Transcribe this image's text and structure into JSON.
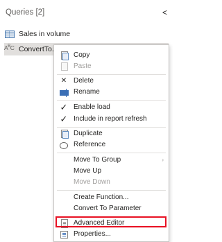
{
  "queries_pane": {
    "header": "Queries [2]",
    "collapse_glyph": "<",
    "items": [
      {
        "label": "Sales in volume",
        "icon": "table-icon"
      },
      {
        "label": "ConvertTo...",
        "icon": "abc-text-icon"
      }
    ]
  },
  "context_menu": {
    "copy": "Copy",
    "paste": "Paste",
    "delete": "Delete",
    "rename": "Rename",
    "enable_load": "Enable load",
    "include_refresh": "Include in report refresh",
    "duplicate": "Duplicate",
    "reference": "Reference",
    "move_to_group": "Move To Group",
    "move_up": "Move Up",
    "move_down": "Move Down",
    "create_function": "Create Function...",
    "convert_to_parameter": "Convert To Parameter",
    "advanced_editor": "Advanced Editor",
    "properties": "Properties..."
  },
  "colors": {
    "highlight_border": "#e81123",
    "selected_row": "#e1dfdd",
    "disabled_text": "#a19f9d"
  }
}
